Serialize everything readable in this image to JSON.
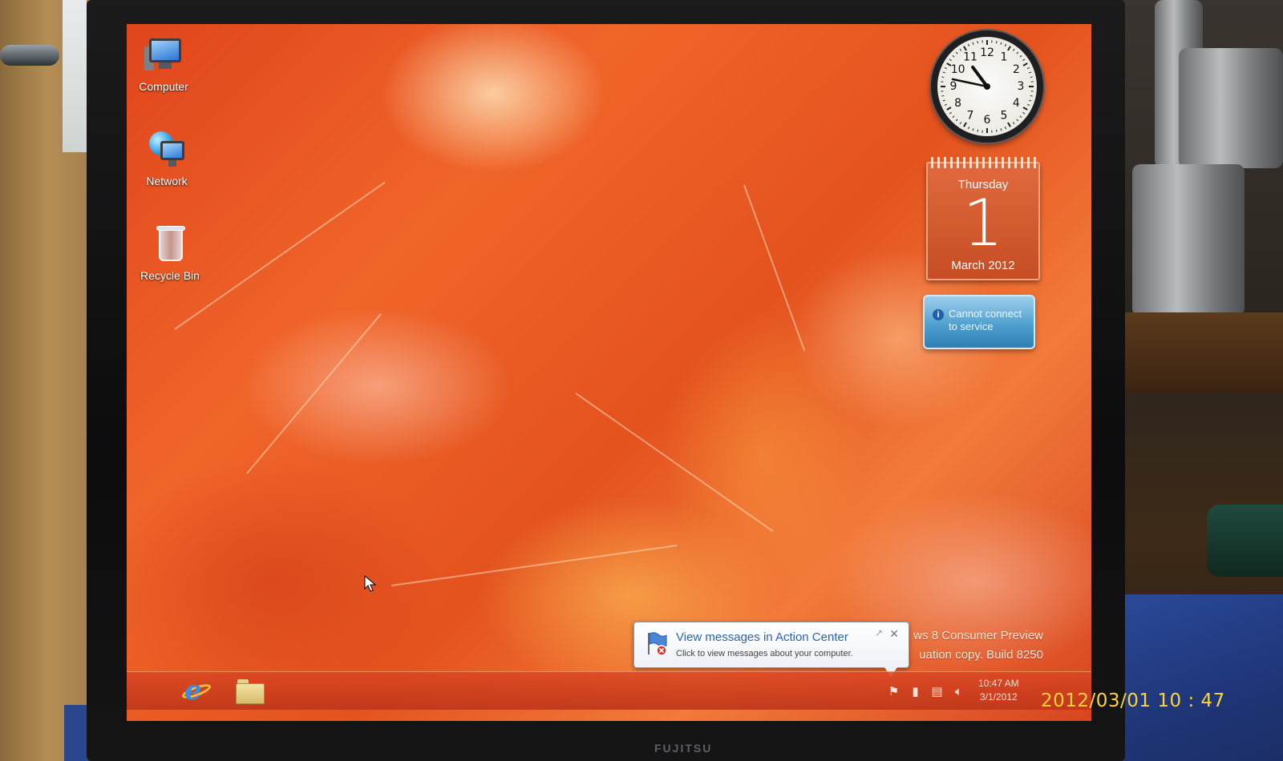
{
  "desktop_icons": [
    {
      "label": "Computer",
      "icon": "computer-icon"
    },
    {
      "label": "Network",
      "icon": "network-icon"
    },
    {
      "label": "Recycle Bin",
      "icon": "recycle-bin-icon"
    }
  ],
  "clock_gadget": {
    "numbers": [
      "12",
      "1",
      "2",
      "3",
      "4",
      "5",
      "6",
      "7",
      "8",
      "9",
      "10",
      "11"
    ],
    "time": "10:47"
  },
  "calendar_gadget": {
    "day_name": "Thursday",
    "day_number": "1",
    "month_year": "March 2012"
  },
  "service_gadget": {
    "message": "Cannot connect to service",
    "icon": "info-icon"
  },
  "watermark": {
    "line1": "ws 8 Consumer Preview",
    "line2": "uation copy. Build 8250"
  },
  "notification": {
    "title": "View messages in Action Center",
    "subtitle": "Click to view messages about your computer.",
    "icon": "action-center-flag-icon"
  },
  "taskbar": {
    "pinned": [
      {
        "name": "Internet Explorer",
        "icon": "internet-explorer-icon"
      },
      {
        "name": "File Explorer",
        "icon": "folder-icon"
      }
    ],
    "tray_icons": [
      "action-center-flag-icon",
      "battery-icon",
      "network-icon",
      "volume-icon"
    ],
    "time": "10:47 AM",
    "date": "3/1/2012"
  },
  "monitor_brand": "FUJITSU",
  "camera_stamp": "2012/03/01  10 : 47",
  "colors": {
    "wallpaper_accent": "#e4521e",
    "taskbar": "#c8401e",
    "notification_title": "#2b63b8",
    "camera_stamp": "#ffd23a"
  }
}
